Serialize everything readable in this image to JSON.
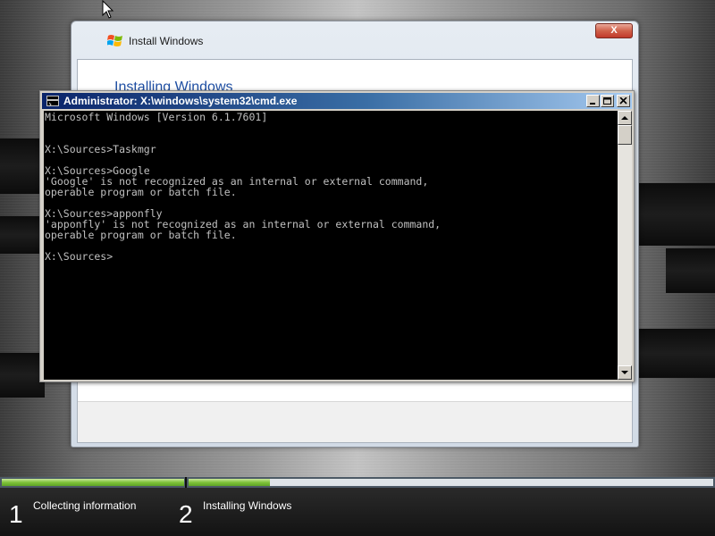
{
  "setup_window": {
    "title": "Install Windows",
    "close_label": "X",
    "heading": "Installing Windows"
  },
  "cmd_window": {
    "title": "Administrator: X:\\windows\\system32\\cmd.exe",
    "lines": [
      "Microsoft Windows [Version 6.1.7601]",
      "",
      "",
      "X:\\Sources>Taskmgr",
      "",
      "X:\\Sources>Google",
      "'Google' is not recognized as an internal or external command,",
      "operable program or batch file.",
      "",
      "X:\\Sources>apponfly",
      "'apponfly' is not recognized as an internal or external command,",
      "operable program or batch file.",
      "",
      "X:\\Sources>"
    ]
  },
  "progress": {
    "steps": [
      {
        "number": "1",
        "label": "Collecting information",
        "fill_fraction": 1.0
      },
      {
        "number": "2",
        "label": "Installing Windows",
        "fill_fraction": 0.155
      }
    ],
    "accent_color": "#7fc23a"
  },
  "icons": {
    "cursor": "arrow-cursor-icon",
    "setup": "windows-flag-icon",
    "cmd": "cmd-prompt-icon"
  }
}
